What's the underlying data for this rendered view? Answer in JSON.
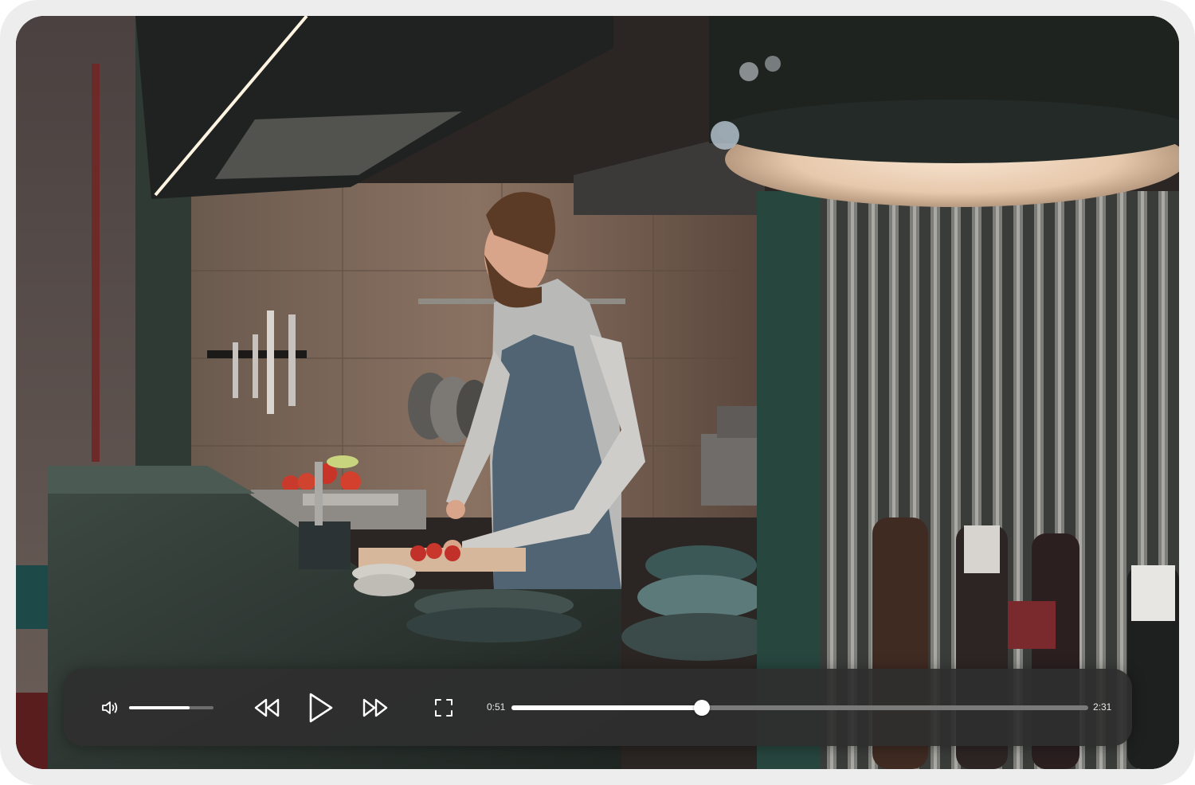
{
  "player": {
    "current_time": "0:51",
    "duration": "2:31",
    "progress": 0.33,
    "volume": 0.72
  },
  "icons": {
    "volume": "speaker-volume-icon",
    "rewind": "rewind-icon",
    "play": "play-icon",
    "forward": "fast-forward-icon",
    "fullscreen": "fullscreen-icon"
  },
  "colors": {
    "control_bar": "#2e2e2e",
    "progress_fill": "#ffffff",
    "progress_track": "#7a7a7a"
  }
}
